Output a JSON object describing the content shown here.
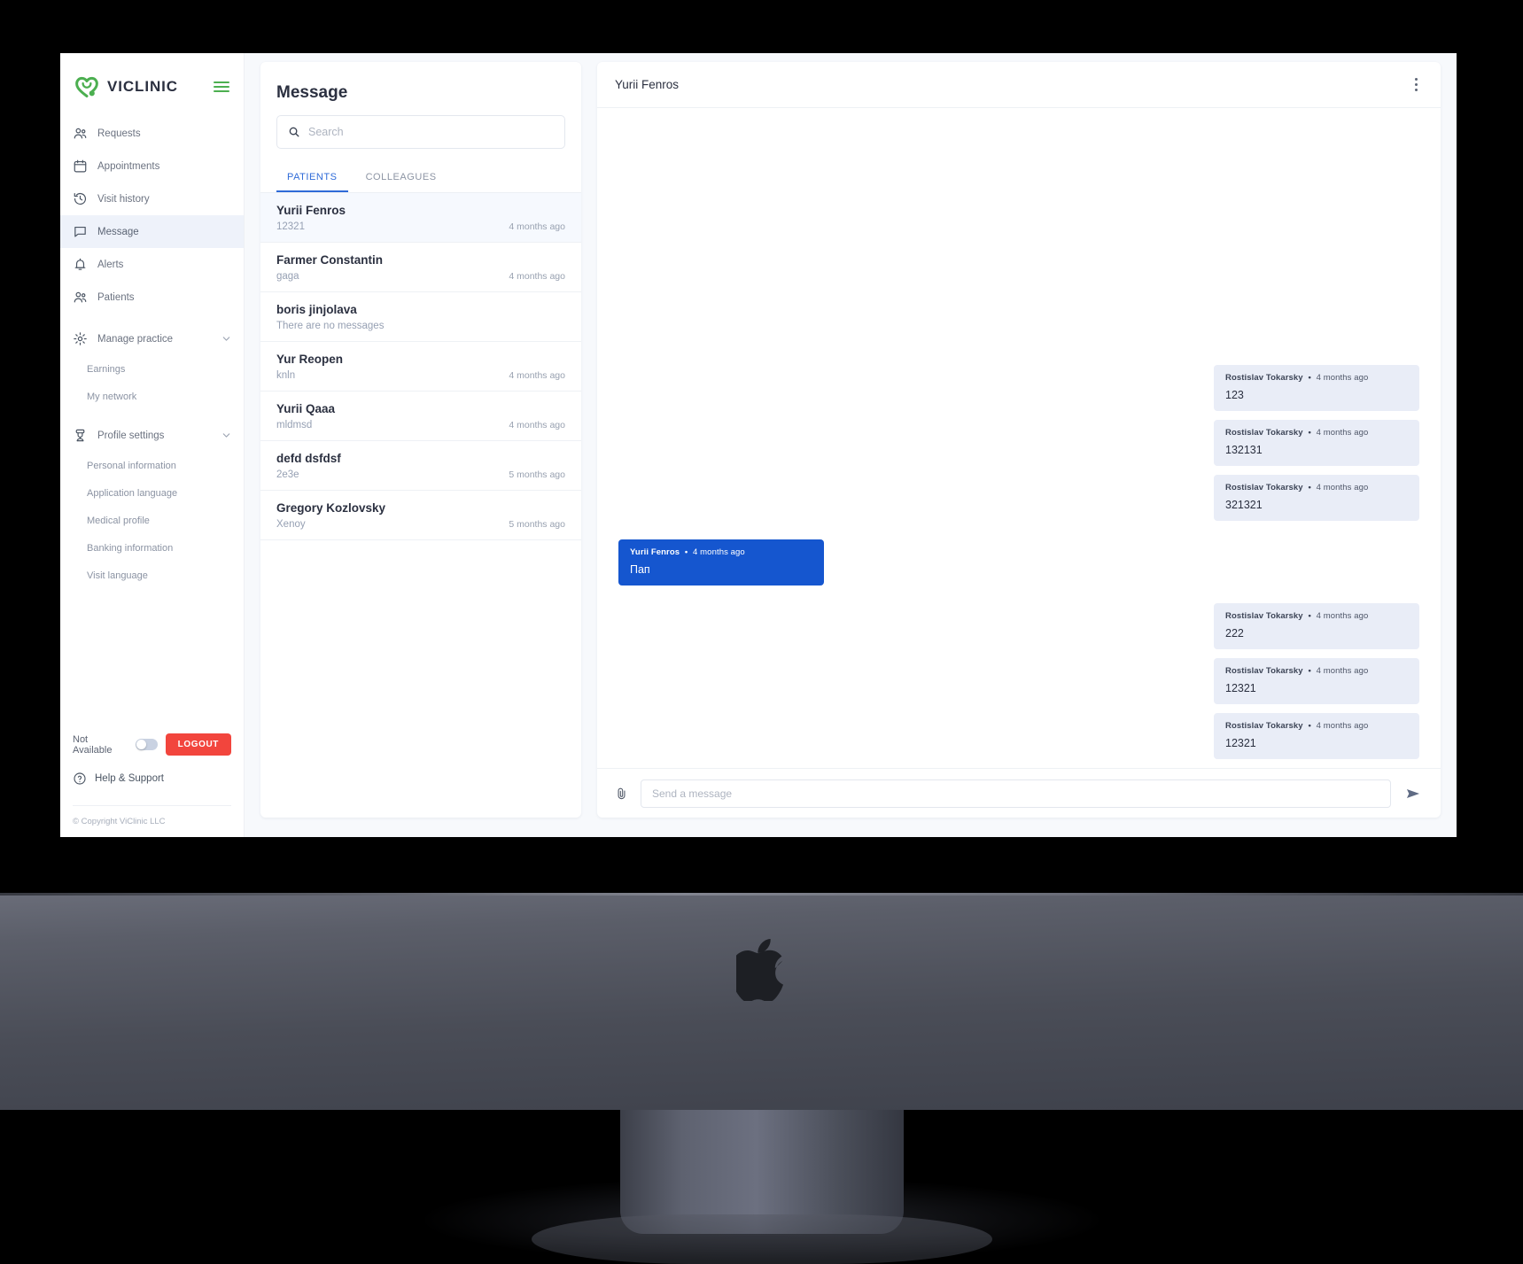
{
  "brand": {
    "name": "VICLINIC",
    "logo_color": "#4caf50"
  },
  "sidebar": {
    "items": [
      {
        "label": "Requests",
        "icon": "people-icon"
      },
      {
        "label": "Appointments",
        "icon": "calendar-icon"
      },
      {
        "label": "Visit history",
        "icon": "history-clock-icon"
      },
      {
        "label": "Message",
        "icon": "chat-bubble-icon"
      },
      {
        "label": "Alerts",
        "icon": "bell-icon"
      },
      {
        "label": "Patients",
        "icon": "people-icon"
      }
    ],
    "active_item": "Message",
    "groups": [
      {
        "label": "Manage practice",
        "icon": "gear-icon",
        "children": [
          "Earnings",
          "My network"
        ]
      },
      {
        "label": "Profile settings",
        "icon": "doctor-icon",
        "children": [
          "Personal information",
          "Application language",
          "Medical profile",
          "Banking information",
          "Visit language"
        ]
      }
    ],
    "availability_label": "Not Available",
    "logout_label": "LOGOUT",
    "help_label": "Help & Support",
    "copyright": "© Copyright ViClinic LLC",
    "accent_logout": "#f2453d"
  },
  "message_panel": {
    "title": "Message",
    "search_placeholder": "Search",
    "search_value": "",
    "tabs": [
      {
        "label": "PATIENTS",
        "active": true
      },
      {
        "label": "COLLEAGUES",
        "active": false
      }
    ],
    "conversations": [
      {
        "name": "Yurii Fenros",
        "snippet": "12321",
        "time": "4 months ago",
        "active": true
      },
      {
        "name": "Farmer Constantin",
        "snippet": "gaga",
        "time": "4 months ago",
        "active": false
      },
      {
        "name": "boris jinjolava",
        "snippet": "There are no messages",
        "time": "",
        "active": false
      },
      {
        "name": "Yur Reopen",
        "snippet": "knln",
        "time": "4 months ago",
        "active": false
      },
      {
        "name": "Yurii Qaaa",
        "snippet": "mldmsd",
        "time": "4 months ago",
        "active": false
      },
      {
        "name": "defd dsfdsf",
        "snippet": "2e3e",
        "time": "5 months ago",
        "active": false
      },
      {
        "name": "Gregory Kozlovsky",
        "snippet": "Xenoy",
        "time": "5 months ago",
        "active": false
      }
    ]
  },
  "chat": {
    "header_name": "Yurii Fenros",
    "menu_icon": "kebab-menu-icon",
    "messages_top": [
      {
        "author": "Rostislav Tokarsky",
        "time": "4 months ago",
        "text": "123",
        "side": "right"
      },
      {
        "author": "Rostislav Tokarsky",
        "time": "4 months ago",
        "text": "132131",
        "side": "right"
      },
      {
        "author": "Rostislav Tokarsky",
        "time": "4 months ago",
        "text": "321321",
        "side": "right"
      }
    ],
    "messages_mine": [
      {
        "author": "Yurii Fenros",
        "time": "4 months ago",
        "text": "Пап",
        "side": "left"
      }
    ],
    "messages_bottom": [
      {
        "author": "Rostislav Tokarsky",
        "time": "4 months ago",
        "text": "222",
        "side": "right"
      },
      {
        "author": "Rostislav Tokarsky",
        "time": "4 months ago",
        "text": "12321",
        "side": "right"
      },
      {
        "author": "Rostislav Tokarsky",
        "time": "4 months ago",
        "text": "12321",
        "side": "right"
      }
    ],
    "composer": {
      "placeholder": "Send a message",
      "value": "",
      "attach_icon": "paperclip-icon",
      "send_icon": "send-arrow-icon"
    },
    "bubble_them_bg": "#e9edf7",
    "bubble_me_bg": "#1556cf",
    "separator": "•"
  }
}
